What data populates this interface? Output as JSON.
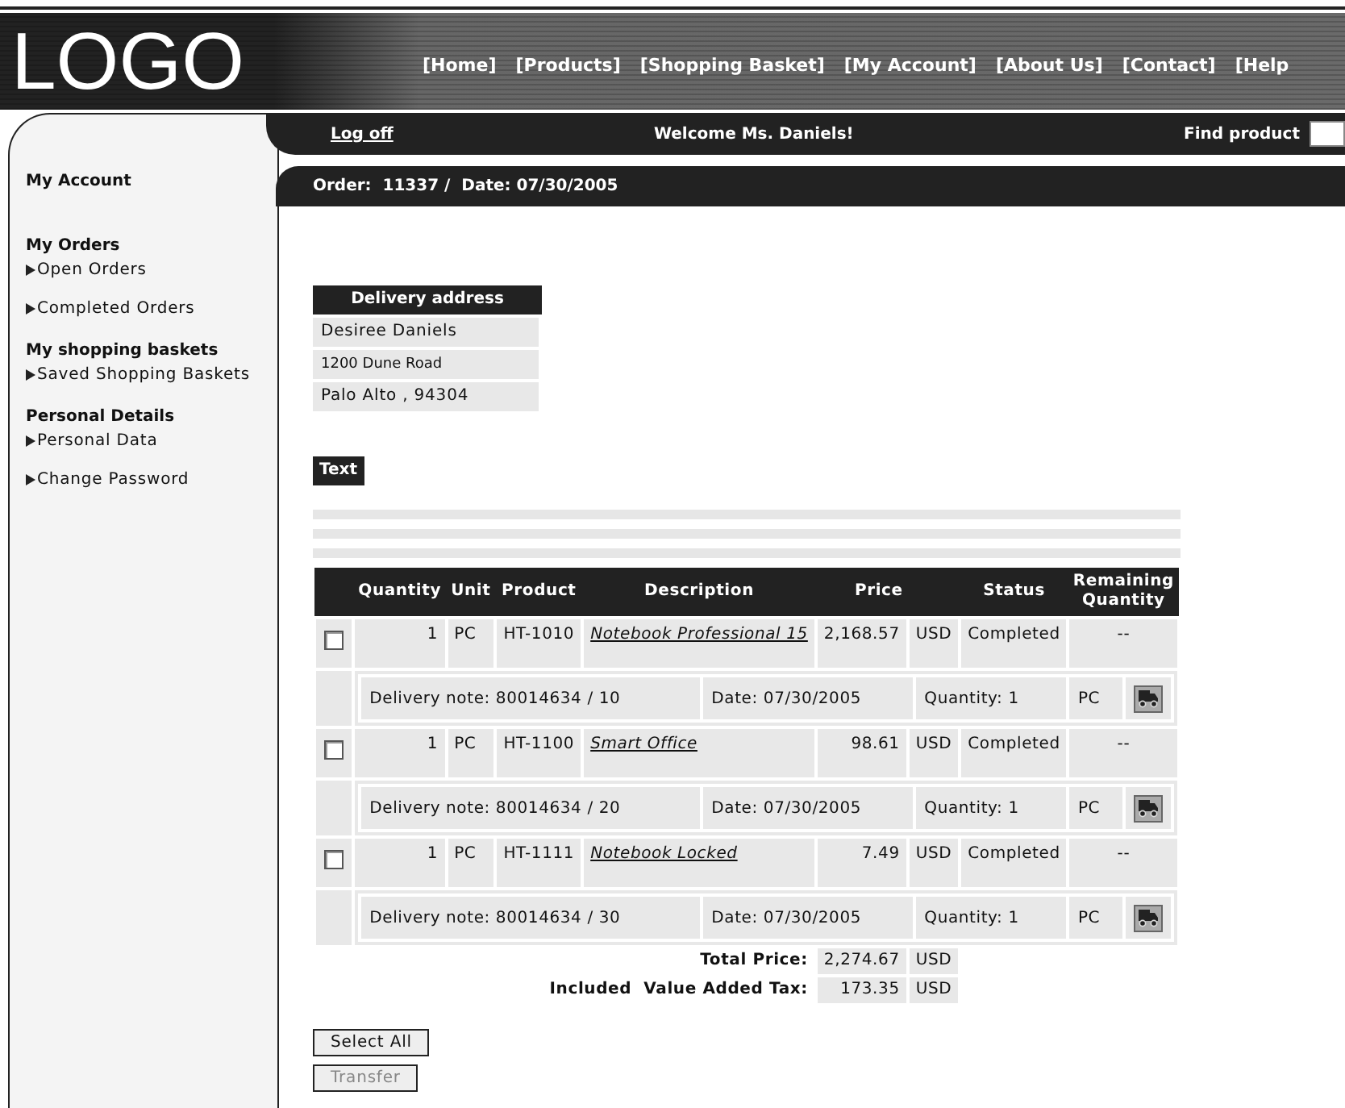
{
  "logo": "LOGO",
  "nav": [
    "[Home]",
    "[Products]",
    "[Shopping Basket]",
    "[My Account]",
    "[About Us]",
    "[Contact]",
    "[Help"
  ],
  "user_bar": {
    "logoff": "Log off",
    "welcome": "Welcome Ms. Daniels!",
    "find_label": "Find product"
  },
  "sidebar": {
    "title": "My Account",
    "sections": [
      {
        "heading": "My Orders",
        "items": [
          "Open Orders",
          "Completed Orders"
        ]
      },
      {
        "heading": "My shopping baskets",
        "items": [
          "Saved Shopping Baskets"
        ]
      },
      {
        "heading": "Personal Details",
        "items": [
          "Personal Data",
          "Change Password"
        ]
      }
    ]
  },
  "order_header": "Order:  11337 /  Date: 07/30/2005",
  "delivery_address": {
    "title": "Delivery address",
    "lines": [
      "Desiree Daniels",
      "1200 Dune Road",
      "Palo Alto , 94304"
    ]
  },
  "text_label": "Text",
  "table": {
    "columns": [
      {
        "label": "Quantity",
        "kind": "plain"
      },
      {
        "label": "Unit",
        "kind": "plain"
      },
      {
        "label": "Product",
        "kind": "plain"
      },
      {
        "label": "Description",
        "kind": "plain"
      },
      {
        "label": "Price",
        "kind": "amount"
      },
      {
        "label": "Status",
        "kind": "plain"
      },
      {
        "label": "Remaining Quantity",
        "kind": "plain"
      }
    ],
    "rows": [
      {
        "checked": false,
        "quantity": "1",
        "unit": "PC",
        "product": "HT-1010",
        "description": "Notebook Professional 15",
        "price": "2,168.57",
        "currency": "USD",
        "status": "Completed",
        "remaining": "--",
        "delivery": {
          "note": "Delivery note: 80014634 / 10",
          "date": "Date: 07/30/2005",
          "quantity": "Quantity: 1",
          "unit": "PC"
        }
      },
      {
        "checked": false,
        "quantity": "1",
        "unit": "PC",
        "product": "HT-1100",
        "description": "Smart Office",
        "price": "98.61",
        "currency": "USD",
        "status": "Completed",
        "remaining": "--",
        "delivery": {
          "note": "Delivery note: 80014634 / 20",
          "date": "Date: 07/30/2005",
          "quantity": "Quantity: 1",
          "unit": "PC"
        }
      },
      {
        "checked": false,
        "quantity": "1",
        "unit": "PC",
        "product": "HT-1111",
        "description": "Notebook Locked",
        "price": "7.49",
        "currency": "USD",
        "status": "Completed",
        "remaining": "--",
        "delivery": {
          "note": "Delivery note: 80014634 / 30",
          "date": "Date: 07/30/2005",
          "quantity": "Quantity: 1",
          "unit": "PC"
        }
      }
    ],
    "totals": [
      {
        "label": "Total Price:",
        "value": "2,274.67",
        "currency": "USD"
      },
      {
        "label": "Included  Value Added Tax:",
        "value": "173.35",
        "currency": "USD"
      }
    ]
  },
  "buttons": [
    {
      "label": "Select All",
      "disabled": false
    },
    {
      "label": "Transfer",
      "disabled": true
    }
  ]
}
